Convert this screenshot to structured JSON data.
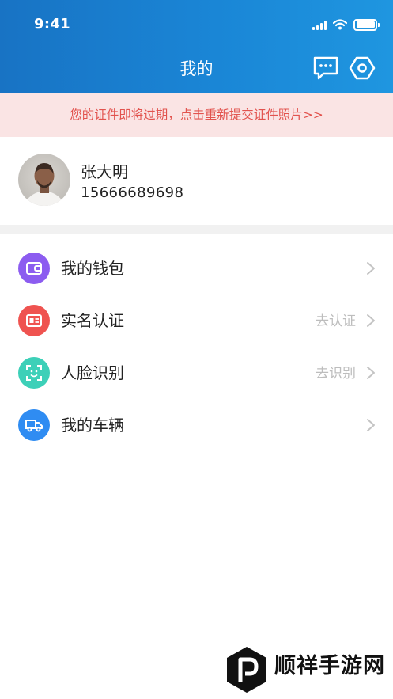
{
  "status_bar": {
    "time": "9:41",
    "icons": [
      "signal-icon",
      "wifi-icon",
      "battery-icon"
    ]
  },
  "header": {
    "title": "我的",
    "actions": [
      "message-icon",
      "settings-icon"
    ],
    "background_color": "#1a7fd0"
  },
  "notice": {
    "text": "您的证件即将过期，点击重新提交证件照片>>",
    "color": "#e2534e",
    "background": "#fae4e4"
  },
  "profile": {
    "name": "张大明",
    "phone": "15666689698"
  },
  "menu": {
    "items": [
      {
        "label": "我的钱包",
        "hint": "",
        "icon": "wallet-icon",
        "color": "#8c5cf0"
      },
      {
        "label": "实名认证",
        "hint": "去认证",
        "icon": "id-card-icon",
        "color": "#ef5350"
      },
      {
        "label": "人脸识别",
        "hint": "去识别",
        "icon": "face-scan-icon",
        "color": "#3dd0b8"
      },
      {
        "label": "我的车辆",
        "hint": "",
        "icon": "truck-icon",
        "color": "#2f8cf2"
      }
    ]
  },
  "watermark": {
    "text": "顺祥手游网"
  }
}
